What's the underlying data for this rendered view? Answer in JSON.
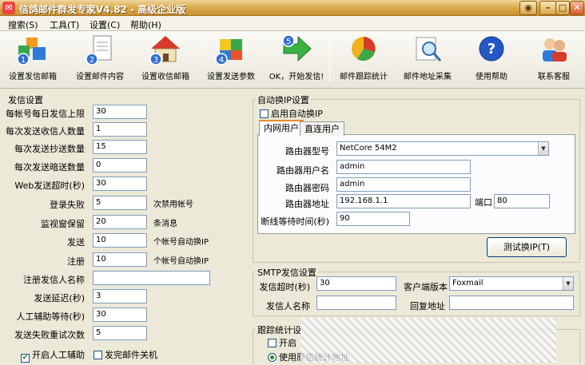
{
  "window": {
    "title": "信鸽邮件群发专家V4.82 - 高级企业版",
    "controls": [
      "◉",
      "–",
      "□",
      "✕"
    ]
  },
  "menu": [
    "搜索(S)",
    "工具(T)",
    "设置(C)",
    "帮助(H)"
  ],
  "toolbar": [
    {
      "label": "设置发信邮箱",
      "step": "1",
      "icon": "cubes-icon"
    },
    {
      "label": "设置邮件内容",
      "step": "2",
      "icon": "document-icon"
    },
    {
      "label": "设置收信邮箱",
      "step": "3",
      "icon": "house-icon"
    },
    {
      "label": "设置发送参数",
      "step": "4",
      "icon": "puzzle-icon"
    },
    {
      "label": "OK，开始发信!",
      "step": "5",
      "icon": "arrow-icon"
    },
    {
      "label": "邮件跟踪统计",
      "icon": "pie-chart-icon"
    },
    {
      "label": "邮件地址采集",
      "icon": "magnifier-icon"
    },
    {
      "label": "使用帮助",
      "icon": "help-icon"
    },
    {
      "label": "联系客服",
      "icon": "support-icon"
    }
  ],
  "send_settings": {
    "title": "发信设置",
    "fields": [
      {
        "label": "每帐号每日发信上限",
        "value": "30",
        "note": ""
      },
      {
        "label": "每次发送收信人数量",
        "value": "1",
        "note": ""
      },
      {
        "label": "每次发送抄送数量",
        "value": "15",
        "note": ""
      },
      {
        "label": "每次发送暗送数量",
        "value": "0",
        "note": ""
      },
      {
        "label": "Web发送超时(秒)",
        "value": "30",
        "note": ""
      },
      {
        "label": "登录失败",
        "value": "5",
        "note": "次禁用帐号"
      },
      {
        "label": "监视窗保留",
        "value": "20",
        "note": "条消息"
      },
      {
        "label": "发送",
        "value": "10",
        "note": "个帐号自动换IP"
      },
      {
        "label": "注册",
        "value": "10",
        "note": "个帐号自动换IP"
      },
      {
        "label": "注册发信人名称",
        "value": "",
        "note": ""
      },
      {
        "label": "发送延迟(秒)",
        "value": "3",
        "note": ""
      },
      {
        "label": "人工辅助等待(秒)",
        "value": "30",
        "note": ""
      },
      {
        "label": "发送失败重试次数",
        "value": "5",
        "note": ""
      }
    ],
    "check_manual": "开启人工辅助",
    "check_shutdown": "发完邮件关机"
  },
  "auto_ip": {
    "title": "自动换IP设置",
    "enable": "启用自动换IP",
    "tabs": [
      "内网用户",
      "直连用户"
    ],
    "router_model_label": "路由器型号",
    "router_model": "NetCore 54M2",
    "router_user_label": "路由器用户名",
    "router_user": "admin",
    "router_pass_label": "路由器密码",
    "router_pass": "admin",
    "router_addr_label": "路由器地址",
    "router_addr": "192.168.1.1",
    "port_label": "端口",
    "port": "80",
    "wait_label": "断线等待时间(秒)",
    "wait": "90",
    "test_button": "测试换IP(T)"
  },
  "smtp": {
    "title": "SMTP发信设置",
    "timeout_label": "发信超时(秒)",
    "timeout": "30",
    "client_label": "客户端版本",
    "client": "Foxmail",
    "sender_label": "发信人名称",
    "sender": "",
    "reply_label": "回复地址",
    "reply": ""
  },
  "tracking": {
    "title": "跟踪统计设",
    "enable": "开启",
    "radio": "使用原信统计地址"
  }
}
